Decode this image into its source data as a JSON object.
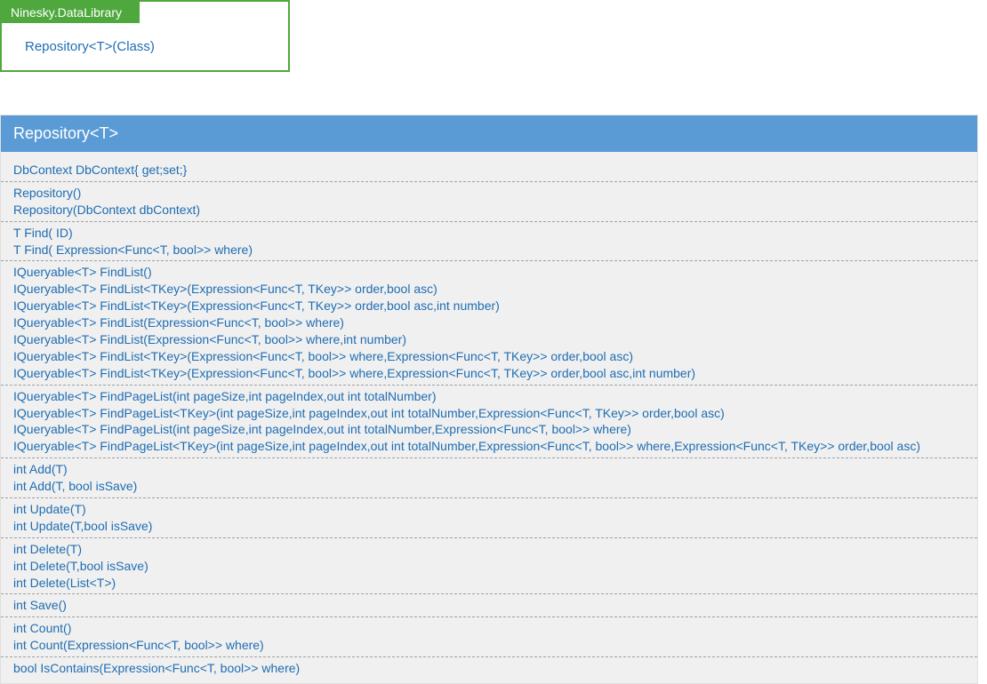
{
  "namespace": {
    "name": "Ninesky.DataLibrary",
    "items": [
      "Repository<T>(Class)"
    ]
  },
  "classDetail": {
    "title": "Repository<T>",
    "groups": [
      [
        "DbContext DbContext{ get;set;}"
      ],
      [
        "Repository()",
        "Repository(DbContext dbContext)"
      ],
      [
        "T Find( ID)",
        "T Find( Expression<Func<T, bool>> where)"
      ],
      [
        "IQueryable<T> FindList()",
        "IQueryable<T> FindList<TKey>(Expression<Func<T, TKey>> order,bool asc)",
        "IQueryable<T> FindList<TKey>(Expression<Func<T, TKey>> order,bool asc,int number)",
        "IQueryable<T> FindList(Expression<Func<T, bool>> where)",
        "IQueryable<T> FindList(Expression<Func<T, bool>> where,int number)",
        "IQueryable<T> FindList<TKey>(Expression<Func<T, bool>> where,Expression<Func<T, TKey>> order,bool asc)",
        "IQueryable<T> FindList<TKey>(Expression<Func<T, bool>> where,Expression<Func<T, TKey>> order,bool asc,int number)"
      ],
      [
        "IQueryable<T> FindPageList(int pageSize,int pageIndex,out int totalNumber)",
        "IQueryable<T> FindPageList<TKey>(int pageSize,int pageIndex,out int totalNumber,Expression<Func<T, TKey>> order,bool asc)",
        "IQueryable<T> FindPageList(int pageSize,int pageIndex,out int totalNumber,Expression<Func<T, bool>> where)",
        "IQueryable<T> FindPageList<TKey>(int pageSize,int pageIndex,out int totalNumber,Expression<Func<T, bool>> where,Expression<Func<T, TKey>> order,bool asc)"
      ],
      [
        "int Add(T)",
        "int Add(T, bool isSave)"
      ],
      [
        "int Update(T)",
        "int Update(T,bool isSave)"
      ],
      [
        "int Delete(T)",
        "int Delete(T,bool isSave)",
        "int Delete(List<T>)"
      ],
      [
        "int Save()"
      ],
      [
        "int Count()",
        "int Count(Expression<Func<T, bool>> where)"
      ],
      [
        "bool IsContains(Expression<Func<T, bool>> where)"
      ]
    ]
  }
}
